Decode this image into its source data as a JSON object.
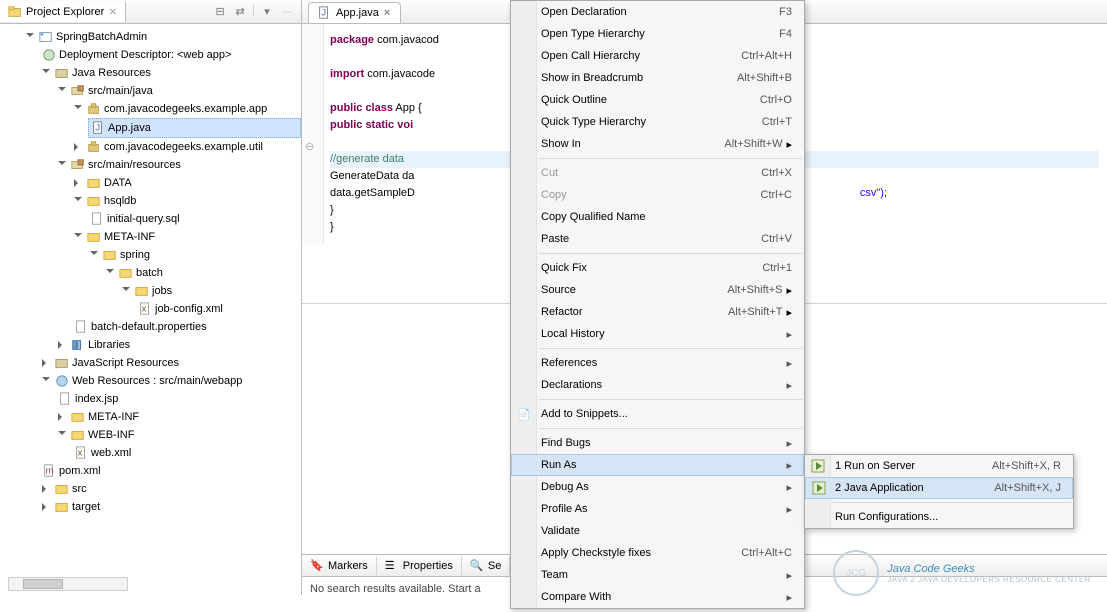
{
  "explorer": {
    "title": "Project Explorer",
    "tree": {
      "project": "SpringBatchAdmin",
      "deployment": "Deployment Descriptor: <web app>",
      "javaRes": "Java Resources",
      "srcMainJava": "src/main/java",
      "pkgApp": "com.javacodegeeks.example.app",
      "appJava": "App.java",
      "pkgUtil": "com.javacodegeeks.example.util",
      "srcMainRes": "src/main/resources",
      "data": "DATA",
      "hsqldb": "hsqldb",
      "initialQuery": "initial-query.sql",
      "metaInf": "META-INF",
      "spring": "spring",
      "batch": "batch",
      "jobs": "jobs",
      "jobConfig": "job-config.xml",
      "batchDefault": "batch-default.properties",
      "libraries": "Libraries",
      "jsRes": "JavaScript Resources",
      "webRes": "Web Resources : src/main/webapp",
      "indexJsp": "index.jsp",
      "metaInf2": "META-INF",
      "webInf": "WEB-INF",
      "webXml": "web.xml",
      "pom": "pom.xml",
      "src": "src",
      "target": "target"
    }
  },
  "editor": {
    "tab": "App.java",
    "lines": {
      "l1a": "package",
      "l1b": " com.javacod",
      "l3a": "import",
      "l3b": " com.javacode",
      "l5a": "public class",
      "l5b": " App {",
      "l6a": "    public static voi",
      "l8": "        //generate data",
      "l9": "        GenerateData da",
      "l10": "        data.getSampleD",
      "l11": "    }",
      "l12": "}",
      "tail": "csv\");"
    }
  },
  "bottom": {
    "markers": "Markers",
    "properties": "Properties",
    "search": "Se",
    "msg": "No search results available. Start a"
  },
  "ctx": [
    {
      "label": "Open Declaration",
      "sc": "F3"
    },
    {
      "label": "Open Type Hierarchy",
      "sc": "F4"
    },
    {
      "label": "Open Call Hierarchy",
      "sc": "Ctrl+Alt+H"
    },
    {
      "label": "Show in Breadcrumb",
      "sc": "Alt+Shift+B"
    },
    {
      "label": "Quick Outline",
      "sc": "Ctrl+O"
    },
    {
      "label": "Quick Type Hierarchy",
      "sc": "Ctrl+T"
    },
    {
      "label": "Show In",
      "sc": "Alt+Shift+W",
      "sub": true
    },
    {
      "sep": true
    },
    {
      "label": "Cut",
      "sc": "Ctrl+X",
      "disabled": true
    },
    {
      "label": "Copy",
      "sc": "Ctrl+C",
      "disabled": true
    },
    {
      "label": "Copy Qualified Name"
    },
    {
      "label": "Paste",
      "sc": "Ctrl+V"
    },
    {
      "sep": true
    },
    {
      "label": "Quick Fix",
      "sc": "Ctrl+1"
    },
    {
      "label": "Source",
      "sc": "Alt+Shift+S",
      "sub": true
    },
    {
      "label": "Refactor",
      "sc": "Alt+Shift+T",
      "sub": true
    },
    {
      "label": "Local History",
      "sub": true
    },
    {
      "sep": true
    },
    {
      "label": "References",
      "sub": true
    },
    {
      "label": "Declarations",
      "sub": true
    },
    {
      "sep": true
    },
    {
      "label": "Add to Snippets...",
      "icon": true
    },
    {
      "sep": true
    },
    {
      "label": "Find Bugs",
      "sub": true
    },
    {
      "label": "Run As",
      "sub": true,
      "highlight": true
    },
    {
      "label": "Debug As",
      "sub": true
    },
    {
      "label": "Profile As",
      "sub": true
    },
    {
      "label": "Validate"
    },
    {
      "label": "Apply Checkstyle fixes",
      "sc": "Ctrl+Alt+C"
    },
    {
      "label": "Team",
      "sub": true
    },
    {
      "label": "Compare With",
      "sub": true
    }
  ],
  "submenu": [
    {
      "label": "1 Run on Server",
      "sc": "Alt+Shift+X, R",
      "icon": "server"
    },
    {
      "label": "2 Java Application",
      "sc": "Alt+Shift+X, J",
      "icon": "java",
      "highlight": true
    },
    {
      "sep": true
    },
    {
      "label": "Run Configurations..."
    }
  ],
  "watermark": {
    "main": "Java Code Geeks",
    "sub": "JAVA 2 JAVA DEVELOPERS RESOURCE CENTER",
    "logo": "JCG"
  }
}
